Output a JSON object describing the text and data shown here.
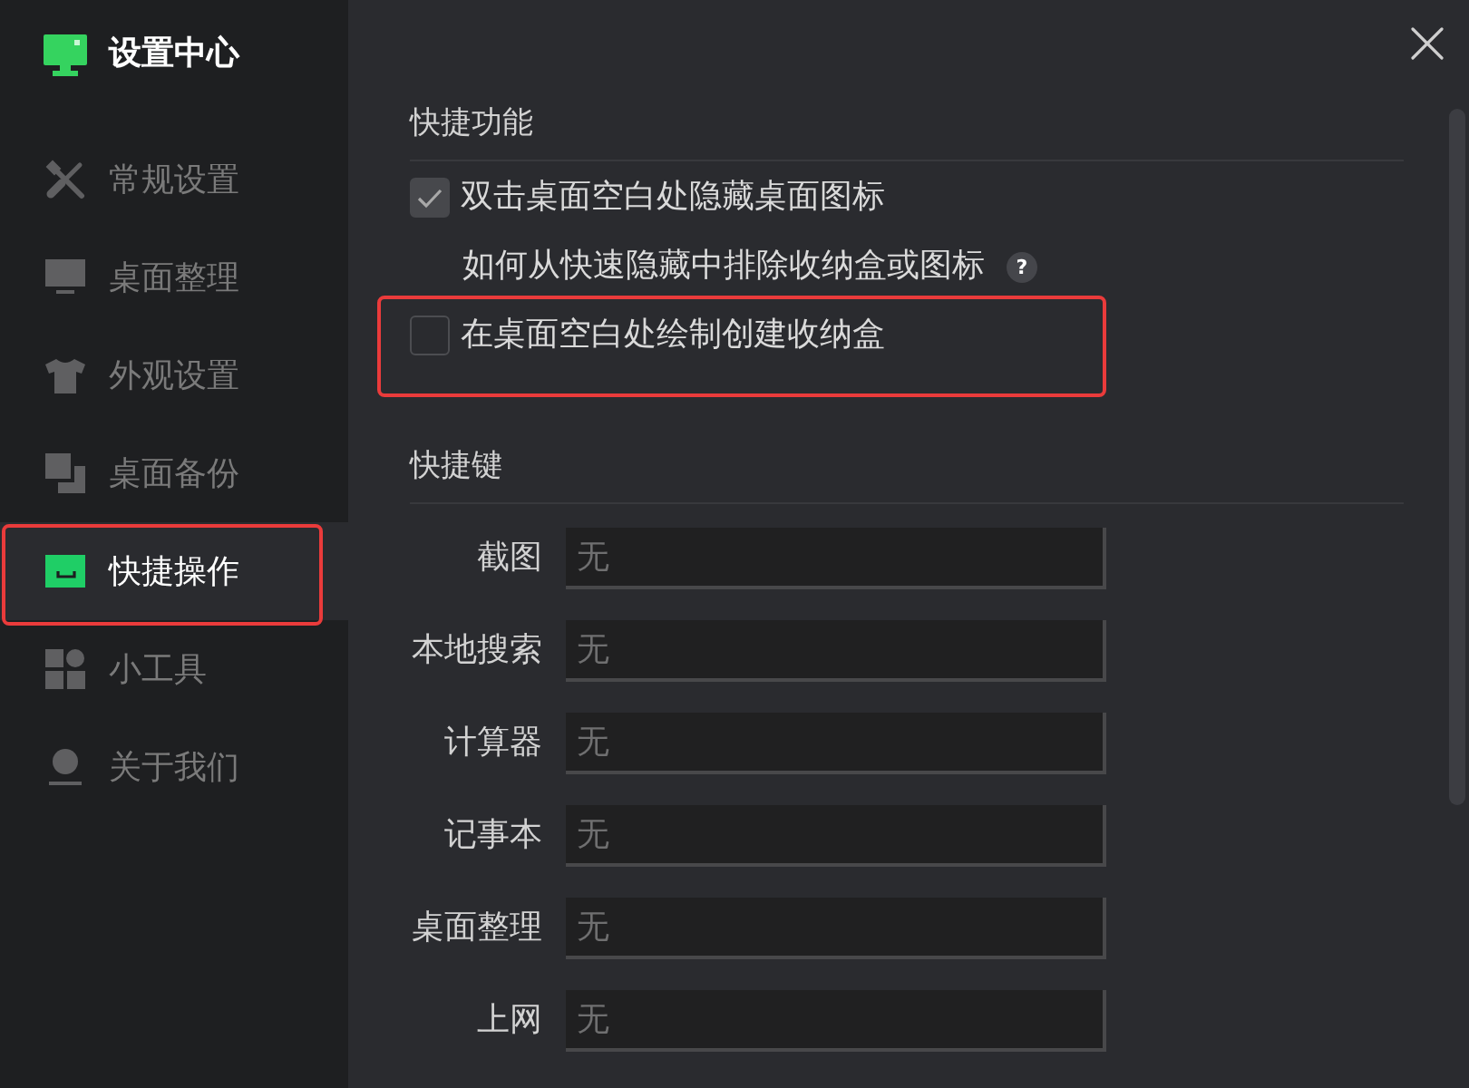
{
  "app": {
    "title": "设置中心"
  },
  "sidebar": {
    "items": [
      {
        "label": "常规设置",
        "selected": false,
        "highlighted": false
      },
      {
        "label": "桌面整理",
        "selected": false,
        "highlighted": false
      },
      {
        "label": "外观设置",
        "selected": false,
        "highlighted": false
      },
      {
        "label": "桌面备份",
        "selected": false,
        "highlighted": false
      },
      {
        "label": "快捷操作",
        "selected": true,
        "highlighted": true
      },
      {
        "label": "小工具",
        "selected": false,
        "highlighted": false
      },
      {
        "label": "关于我们",
        "selected": false,
        "highlighted": false
      }
    ]
  },
  "quick_features": {
    "heading": "快捷功能",
    "options": [
      {
        "kind": "checkbox",
        "label": "双击桌面空白处隐藏桌面图标",
        "checked": true,
        "highlighted": false
      },
      {
        "kind": "help",
        "label": "如何从快速隐藏中排除收纳盒或图标",
        "help": "?",
        "highlighted": false
      },
      {
        "kind": "checkbox",
        "label": "在桌面空白处绘制创建收纳盒",
        "checked": false,
        "highlighted": true
      }
    ]
  },
  "shortcuts": {
    "heading": "快捷键",
    "rows": [
      {
        "label": "截图",
        "placeholder": "无"
      },
      {
        "label": "本地搜索",
        "placeholder": "无"
      },
      {
        "label": "计算器",
        "placeholder": "无"
      },
      {
        "label": "记事本",
        "placeholder": "无"
      },
      {
        "label": "桌面整理",
        "placeholder": "无"
      },
      {
        "label": "上网",
        "placeholder": "无"
      }
    ]
  }
}
